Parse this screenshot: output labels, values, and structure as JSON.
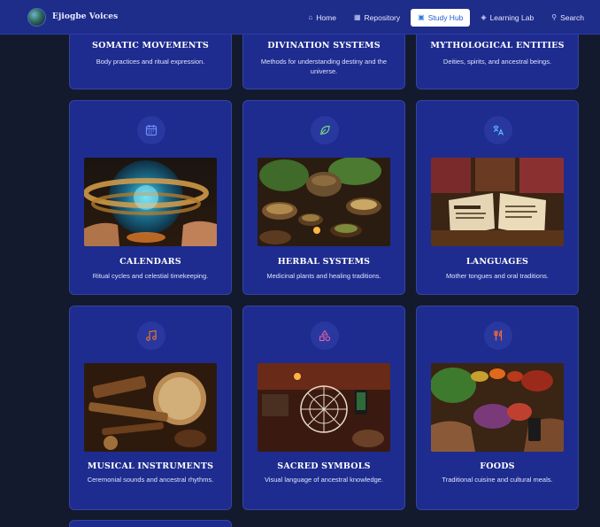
{
  "app": {
    "name": "Ejiogbe Voices"
  },
  "nav": {
    "items": [
      {
        "label": "Home",
        "icon": "home-icon"
      },
      {
        "label": "Repository",
        "icon": "archive-icon"
      },
      {
        "label": "Study Hub",
        "icon": "book-icon",
        "active": true
      },
      {
        "label": "Learning Lab",
        "icon": "graduation-cap-icon"
      },
      {
        "label": "Search",
        "icon": "search-icon"
      }
    ]
  },
  "top_cards": [
    {
      "title": "SOMATIC MOVEMENTS",
      "description": "Body practices and ritual expression."
    },
    {
      "title": "DIVINATION SYSTEMS",
      "description": "Methods for understanding destiny and the universe."
    },
    {
      "title": "MYTHOLOGICAL ENTITIES",
      "description": "Deities, spirits, and ancestral beings."
    }
  ],
  "cards": [
    {
      "title": "CALENDARS",
      "description": "Ritual cycles and celestial timekeeping.",
      "icon": "calendar-icon",
      "icon_color": "#6f8dff"
    },
    {
      "title": "HERBAL SYSTEMS",
      "description": "Medicinal plants and healing traditions.",
      "icon": "leaf-icon",
      "icon_color": "#7bd67f"
    },
    {
      "title": "LANGUAGES",
      "description": "Mother tongues and oral traditions.",
      "icon": "translate-icon",
      "icon_color": "#5ab8ff"
    },
    {
      "title": "MUSICAL INSTRUMENTS",
      "description": "Ceremonial sounds and ancestral rhythms.",
      "icon": "music-note-icon",
      "icon_color": "#e0713a"
    },
    {
      "title": "SACRED SYMBOLS",
      "description": "Visual language of ancestral knowledge.",
      "icon": "shapes-icon",
      "icon_color": "#e05fa8"
    },
    {
      "title": "FOODS",
      "description": "Traditional cuisine and cultural meals.",
      "icon": "utensils-icon",
      "icon_color": "#ef6a3a"
    }
  ],
  "colors": {
    "background": "#141a2e",
    "nav": "#1e2c8a",
    "card": "#1e2c8f",
    "accent": "#1f5fd0"
  }
}
